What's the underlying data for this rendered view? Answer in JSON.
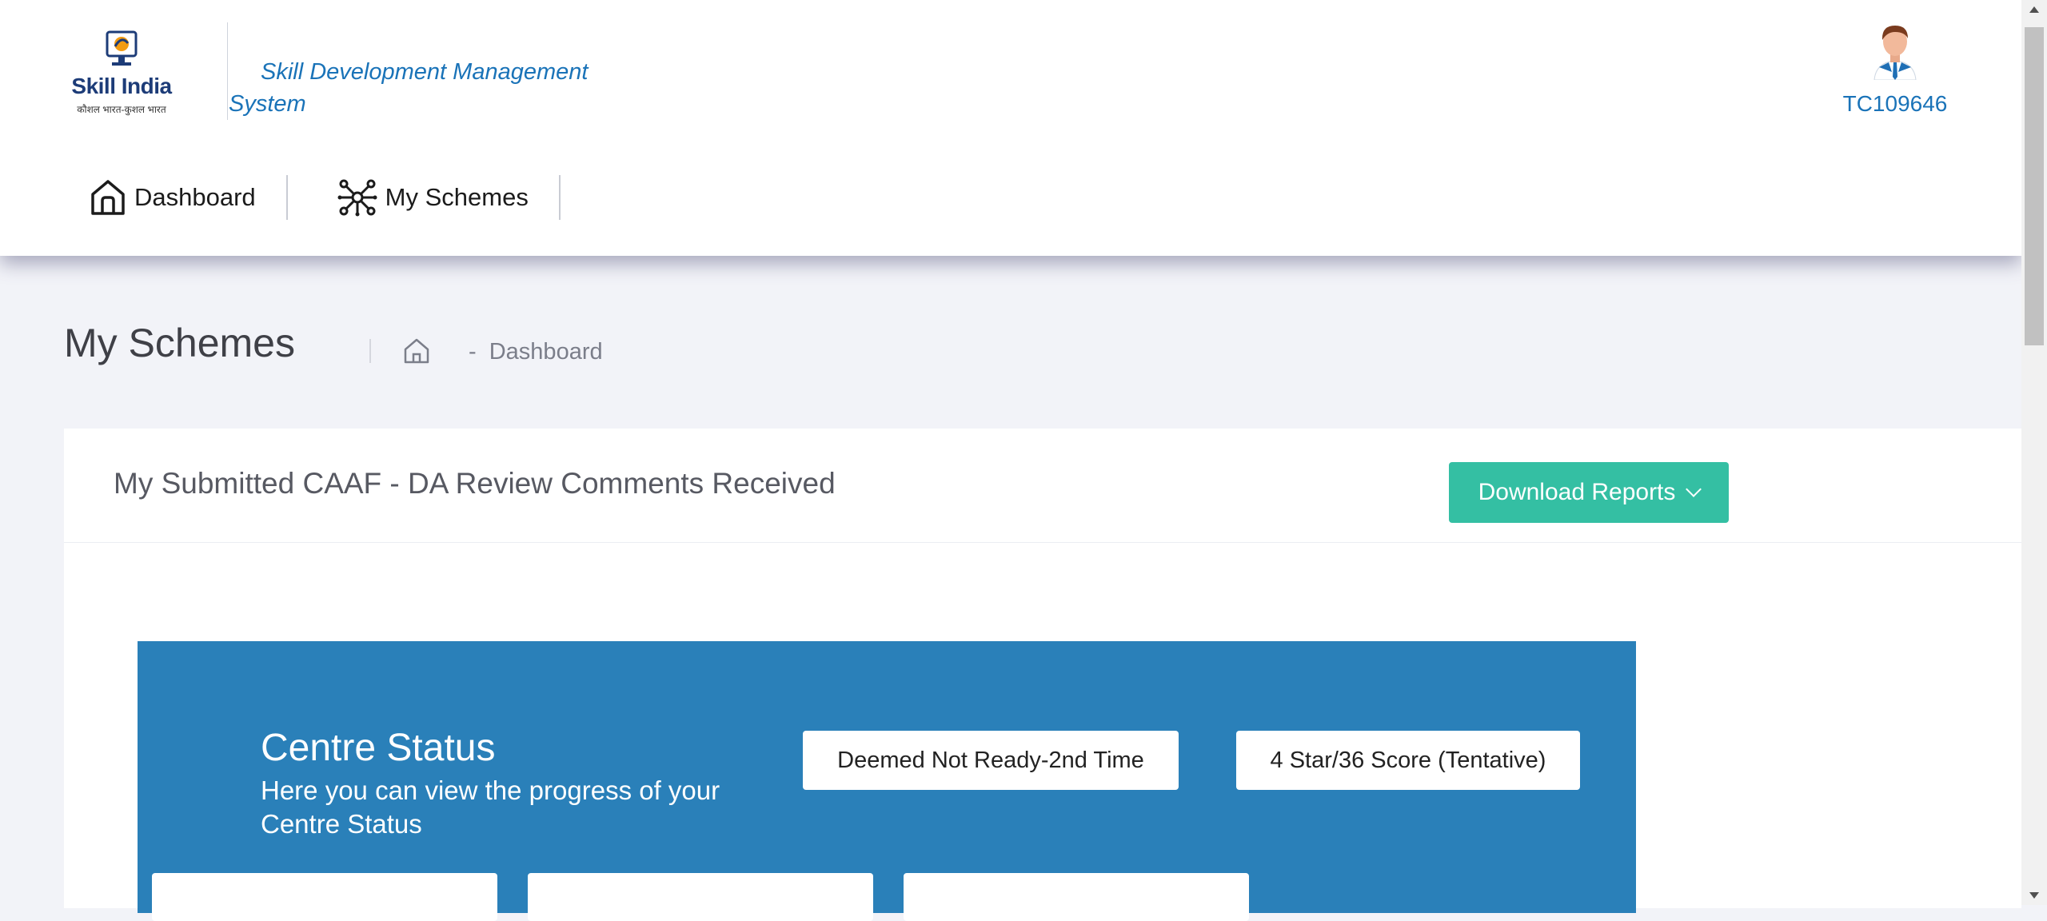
{
  "header": {
    "logo": {
      "brand": "Skill India",
      "tagline": "कौशल भारत-कुशल भारत"
    },
    "system_name_line1": "Skill Development Management",
    "system_name_line2": "System",
    "user_id": "TC109646"
  },
  "nav": {
    "items": [
      {
        "label": "Dashboard",
        "icon": "home-icon"
      },
      {
        "label": "My Schemes",
        "icon": "network-icon"
      }
    ]
  },
  "subheader": {
    "title": "My Schemes",
    "breadcrumb": {
      "home_icon": "home-icon",
      "separator": "-",
      "item": "Dashboard"
    }
  },
  "portlet": {
    "title": "My Submitted CAAF - DA Review Comments Received",
    "download_button": "Download Reports"
  },
  "centre_status": {
    "title": "Centre Status",
    "description": "Here you can view the progress of your Centre Status",
    "status_badge": "Deemed Not Ready-2nd Time",
    "score_badge": "4 Star/36 Score (Tentative)"
  },
  "colors": {
    "accent_blue": "#1a73b8",
    "panel_blue": "#2a80b9",
    "button_green": "#34bfa3"
  }
}
